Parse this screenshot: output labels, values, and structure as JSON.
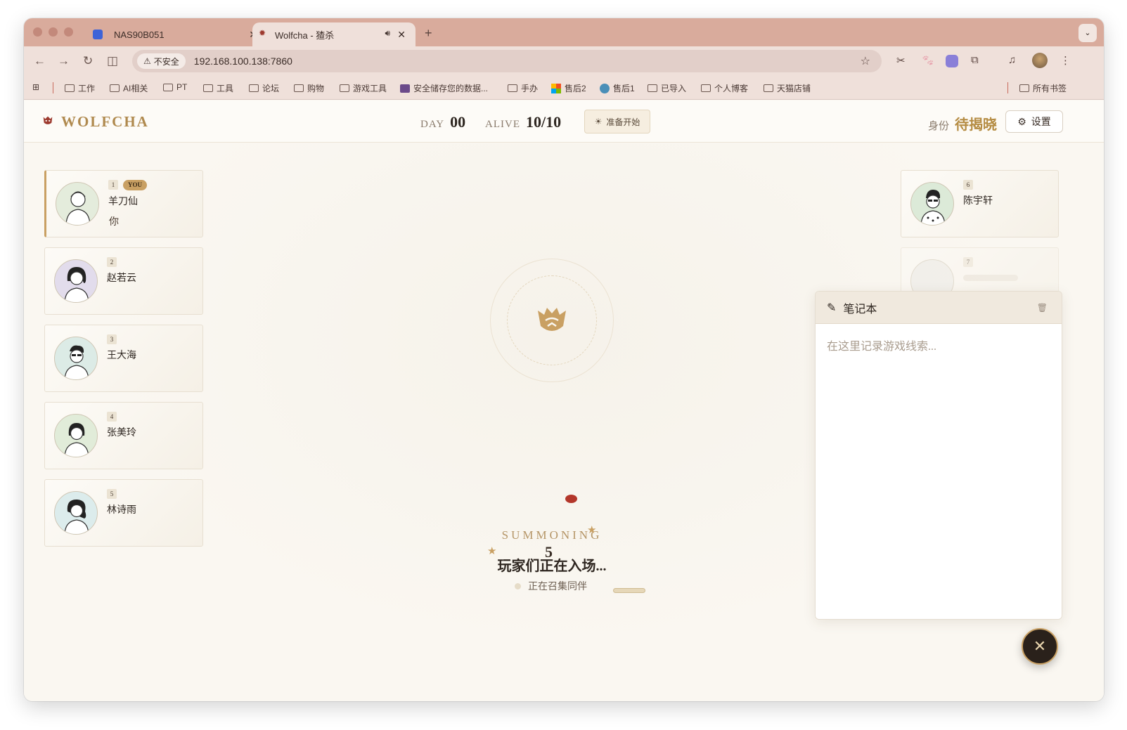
{
  "browser": {
    "tabs": [
      {
        "title": "NAS90B051",
        "active": false
      },
      {
        "title": "Wolfcha - 猹杀",
        "active": true
      }
    ],
    "new_tab": "+",
    "tab_menu": "⌄",
    "security_label": "不安全",
    "url": "192.168.100.138:7860",
    "bookmarks": [
      "工作",
      "AI相关",
      "PT",
      "工具",
      "论坛",
      "购物",
      "游戏工具",
      "安全储存您的数据...",
      "手办",
      "售后2",
      "售后1",
      "已导入",
      "个人博客",
      "天猫店铺"
    ],
    "all_bookmarks": "所有书签"
  },
  "app": {
    "logo": "WOLFCHA",
    "day_label": "DAY",
    "day_value": "00",
    "alive_label": "ALIVE",
    "alive_value": "10/10",
    "ready_button": "准备开始",
    "identity_label": "身份",
    "identity_value": "待揭晓",
    "settings_button": "设置"
  },
  "players_left": [
    {
      "num": "1",
      "name": "羊刀仙",
      "badge": "YOU",
      "sub": "你",
      "bg": "#e4ecdc"
    },
    {
      "num": "2",
      "name": "赵若云",
      "badge": "",
      "sub": "",
      "bg": "#e2dcec"
    },
    {
      "num": "3",
      "name": "王大海",
      "badge": "",
      "sub": "",
      "bg": "#dcebe6"
    },
    {
      "num": "4",
      "name": "张美玲",
      "badge": "",
      "sub": "",
      "bg": "#e1ecd9"
    },
    {
      "num": "5",
      "name": "林诗雨",
      "badge": "",
      "sub": "",
      "bg": "#dcecec"
    }
  ],
  "players_right": [
    {
      "num": "6",
      "name": "陈宇轩",
      "bg": "#dcead8"
    },
    {
      "num": "7",
      "name": "",
      "bg": "#ecebe6"
    }
  ],
  "center": {
    "title": "SUMMONING",
    "subtitle": "玩家们正在入场...",
    "status": "正在召集同伴",
    "count": "5"
  },
  "notebook": {
    "title": "笔记本",
    "placeholder": "在这里记录游戏线索..."
  },
  "colors": {
    "accent": "#c9a063",
    "brand_red": "#9d3a2f",
    "tabstrip": "#d9ab9c"
  }
}
